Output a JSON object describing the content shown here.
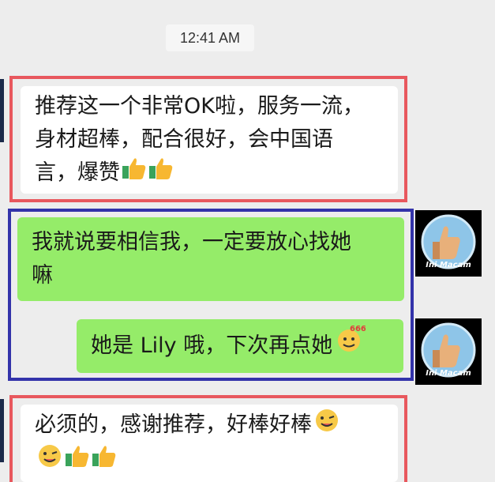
{
  "timestamp": "12:41 AM",
  "messages": [
    {
      "side": "left",
      "lines": [
        "推荐这一个非常OK啦，服务一流，",
        "身材超棒，配合很好，会中国语",
        "言，爆赞"
      ],
      "emoji": [
        "thumbs-up",
        "thumbs-up"
      ]
    },
    {
      "side": "right",
      "lines": [
        "我就说要相信我，一定要放心找她",
        "嘛"
      ],
      "emoji": []
    },
    {
      "side": "right",
      "lines": [
        "她是 Lily 哦，下次再点她"
      ],
      "emoji": [
        "666-face"
      ]
    },
    {
      "side": "left",
      "lines": [
        "必须的，感谢推荐，好棒好棒"
      ],
      "line2_prefix_emoji": [
        "wink-tongue"
      ],
      "emoji": [
        "thumbs-up",
        "thumbs-up"
      ]
    }
  ],
  "avatar": {
    "label": "Ini Macam",
    "icon": "thumbs-up-avatar"
  },
  "colors": {
    "highlight_red": "#e8585e",
    "highlight_blue": "#3333aa",
    "bubble_green": "#95ec69",
    "bubble_white": "#ffffff"
  }
}
